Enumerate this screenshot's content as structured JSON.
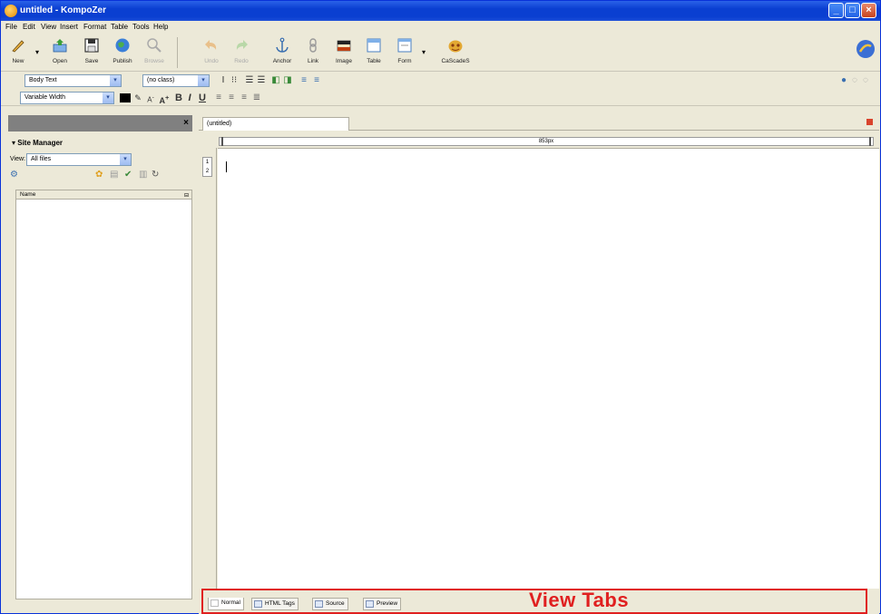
{
  "window": {
    "title": "untitled - KompoZer"
  },
  "menu": [
    "File",
    "Edit",
    "View",
    "Insert",
    "Format",
    "Table",
    "Tools",
    "Help"
  ],
  "toolbar": {
    "new": "New",
    "open": "Open",
    "save": "Save",
    "publish": "Publish",
    "browse": "Browse",
    "undo": "Undo",
    "redo": "Redo",
    "anchor": "Anchor",
    "link": "Link",
    "image": "Image",
    "table": "Table",
    "form": "Form",
    "cascades": "CaScadeS"
  },
  "format": {
    "paragraph_style": "Body Text",
    "class": "(no class)",
    "font": "Variable Width",
    "bold": "B",
    "italic": "I",
    "underline": "U"
  },
  "sidebar": {
    "close_glyph": "×",
    "header": "Site Manager",
    "view_label": "View:",
    "view_value": "All files",
    "column_name": "Name"
  },
  "editor": {
    "tab_title": "(untitled)",
    "ruler_label": "853px"
  },
  "view_tabs": [
    "Normal",
    "HTML Tags",
    "Source",
    "Preview"
  ],
  "annotation": "View Tabs",
  "colors": {
    "title_bar": "#0a3fd1",
    "annotation_red": "#e02020"
  }
}
